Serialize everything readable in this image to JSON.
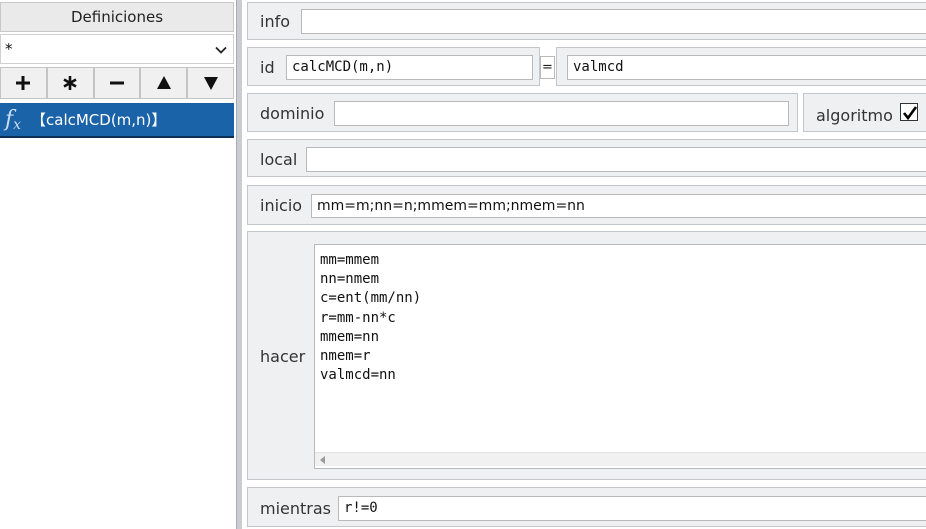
{
  "sidebar": {
    "title": "Definiciones",
    "filter_value": "*",
    "tools": [
      {
        "name": "add-button",
        "icon": "plus-icon"
      },
      {
        "name": "all-button",
        "icon": "asterisk-icon"
      },
      {
        "name": "remove-button",
        "icon": "minus-icon"
      },
      {
        "name": "move-up-button",
        "icon": "triangle-up-icon"
      },
      {
        "name": "move-down-button",
        "icon": "triangle-down-icon"
      }
    ],
    "selected_definition": "【calcMCD(m,n)】"
  },
  "form": {
    "info_label": "info",
    "info_value": "",
    "id_label": "id",
    "id_value": "calcMCD(m,n)",
    "equals": "=",
    "result_value": "valmcd",
    "dominio_label": "dominio",
    "dominio_value": "",
    "algoritmo_label": "algoritmo",
    "algoritmo_checked": true,
    "local_label": "local",
    "local_value": "",
    "inicio_label": "inicio",
    "inicio_value": "mm=m;nn=n;mmem=mm;nmem=nn",
    "hacer_label": "hacer",
    "hacer_value": "mm=mmem\nnn=nmem\nc=ent(mm/nn)\nr=mm-nn*c\nmmem=nn\nnmem=r\nvalmcd=nn",
    "mientras_label": "mientras",
    "mientras_value": "r!=0"
  },
  "colors": {
    "selection": "#1a63a8",
    "panel": "#eef0f2"
  }
}
